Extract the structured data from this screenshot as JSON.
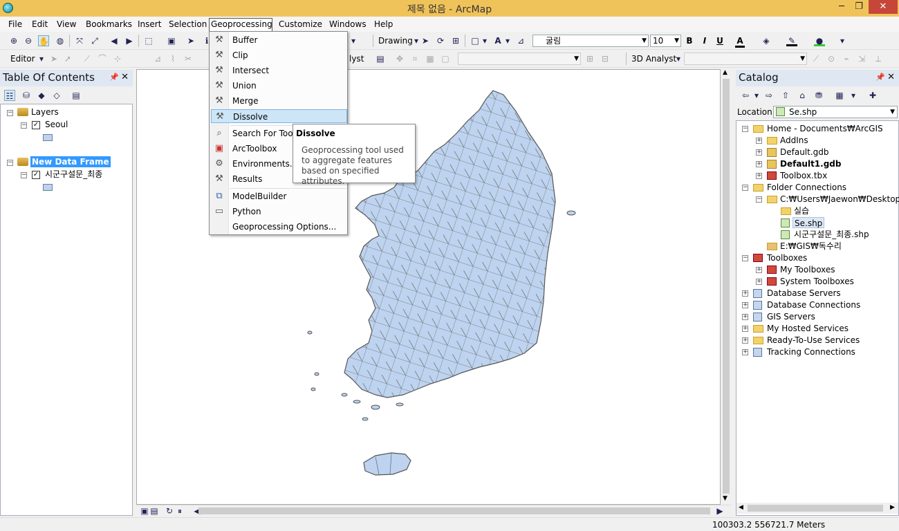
{
  "window": {
    "title": "제목 없음 - ArcMap",
    "min_glyph": "─",
    "max_glyph": "❐",
    "close_glyph": "✕"
  },
  "menubar": {
    "items": [
      "File",
      "Edit",
      "View",
      "Bookmarks",
      "Insert",
      "Selection",
      "Geoprocessing",
      "Customize",
      "Windows",
      "Help"
    ],
    "active": "Geoprocessing"
  },
  "toolbar": {
    "drawing_label": "Drawing",
    "font_name": "굴림",
    "font_size": "10",
    "bold": "B",
    "italic": "I",
    "underline": "U",
    "font_color_glyph": "A",
    "editor_label": "Editor",
    "analyst_partial": "lyst",
    "analyst3d_label": "3D Analyst"
  },
  "toc": {
    "title": "Table Of Contents",
    "frames": [
      {
        "name": "Layers",
        "layers": [
          {
            "name": "Seoul",
            "checked": true
          }
        ]
      },
      {
        "name": "New Data Frame",
        "selected": true,
        "layers": [
          {
            "name": "시군구설문_최종",
            "checked": true
          }
        ]
      }
    ]
  },
  "catalog": {
    "title": "Catalog",
    "location_label": "Location:",
    "location_value": "Se.shp",
    "tree": [
      {
        "label": "Home - Documents₩ArcGIS",
        "level": 0,
        "expanded": true,
        "icon": "home-folder-icon"
      },
      {
        "label": "AddIns",
        "level": 1,
        "expander": "plus",
        "icon": "folder-icon"
      },
      {
        "label": "Default.gdb",
        "level": 1,
        "expander": "plus",
        "icon": "gdb-icon"
      },
      {
        "label": "Default1.gdb",
        "level": 1,
        "expander": "plus",
        "icon": "gdb-icon",
        "bold": true
      },
      {
        "label": "Toolbox.tbx",
        "level": 1,
        "expander": "plus",
        "icon": "toolbox-icon"
      },
      {
        "label": "Folder Connections",
        "level": 0,
        "expanded": true,
        "icon": "folder-connections-icon"
      },
      {
        "label": "C:₩Users₩Jaewon₩Desktop₩GI",
        "level": 1,
        "expanded": true,
        "icon": "folder-icon"
      },
      {
        "label": "실습",
        "level": 2,
        "icon": "folder-icon"
      },
      {
        "label": "Se.shp",
        "level": 2,
        "icon": "shapefile-icon",
        "selected": true
      },
      {
        "label": "시군구설문_최종.shp",
        "level": 2,
        "icon": "shapefile-icon"
      },
      {
        "label": "E:₩GIS₩독수리",
        "level": 1,
        "icon": "folder-disconnected-icon"
      },
      {
        "label": "Toolboxes",
        "level": 0,
        "expanded": true,
        "icon": "toolboxes-icon"
      },
      {
        "label": "My Toolboxes",
        "level": 1,
        "expander": "plus",
        "icon": "toolbox-icon"
      },
      {
        "label": "System Toolboxes",
        "level": 1,
        "expander": "plus",
        "icon": "toolbox-icon"
      },
      {
        "label": "Database Servers",
        "level": 0,
        "expander": "plus",
        "icon": "database-servers-icon"
      },
      {
        "label": "Database Connections",
        "level": 0,
        "expander": "plus",
        "icon": "database-connections-icon"
      },
      {
        "label": "GIS Servers",
        "level": 0,
        "expander": "plus",
        "icon": "gis-servers-icon"
      },
      {
        "label": "My Hosted Services",
        "level": 0,
        "expander": "plus",
        "icon": "hosted-services-icon"
      },
      {
        "label": "Ready-To-Use Services",
        "level": 0,
        "expander": "plus",
        "icon": "ready-services-icon"
      },
      {
        "label": "Tracking Connections",
        "level": 0,
        "expander": "plus",
        "icon": "tracking-icon"
      }
    ]
  },
  "geoprocessing_menu": {
    "items": [
      {
        "label": "Buffer",
        "icon": "hammer-icon"
      },
      {
        "label": "Clip",
        "icon": "hammer-icon"
      },
      {
        "label": "Intersect",
        "icon": "hammer-icon"
      },
      {
        "label": "Union",
        "icon": "hammer-icon"
      },
      {
        "label": "Merge",
        "icon": "hammer-icon"
      },
      {
        "label": "Dissolve",
        "icon": "hammer-icon",
        "highlighted": true
      },
      {
        "label": "Search For Tools",
        "icon": "search-tools-icon"
      },
      {
        "label": "ArcToolbox",
        "icon": "arctoolbox-icon"
      },
      {
        "label": "Environments...",
        "icon": "environments-icon"
      },
      {
        "label": "Results",
        "icon": "results-icon"
      },
      {
        "label": "ModelBuilder",
        "icon": "modelbuilder-icon"
      },
      {
        "label": "Python",
        "icon": "python-icon"
      },
      {
        "label": "Geoprocessing Options...",
        "icon": ""
      }
    ]
  },
  "tooltip": {
    "title": "Dissolve",
    "body": "Geoprocessing tool used to aggregate features based on specified attributes."
  },
  "status": {
    "coordinates": "100303.2  556721.7 Meters"
  },
  "colors": {
    "titlebar": "#f0c35a",
    "polygon_fill": "#bdd3ef",
    "polygon_stroke": "#555555",
    "selection": "#3399ff",
    "menu_highlight": "#cde6f7"
  }
}
